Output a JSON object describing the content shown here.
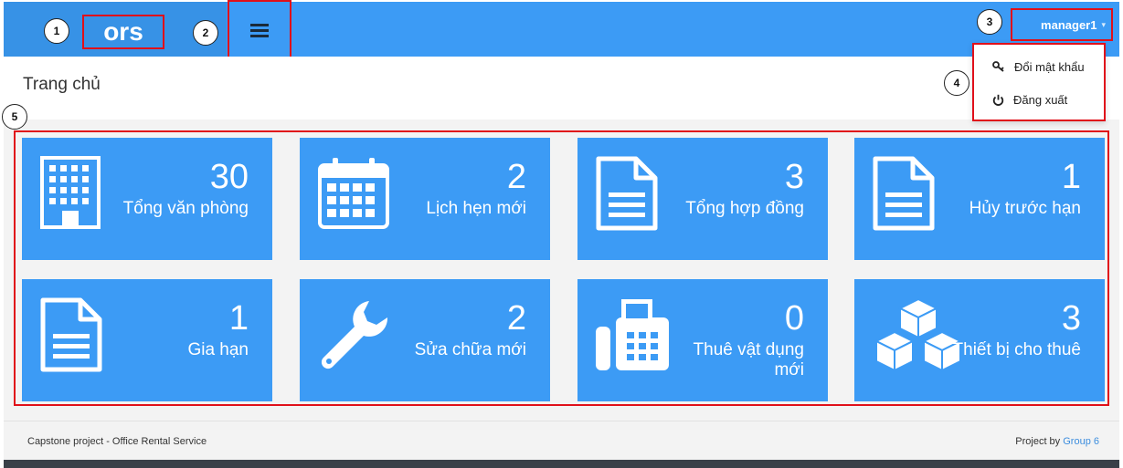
{
  "header": {
    "brand": "ors",
    "user": "manager1"
  },
  "user_dropdown": {
    "items": [
      {
        "label": "Đổi mật khẩu",
        "icon": "key-icon"
      },
      {
        "label": "Đăng xuất",
        "icon": "power-icon"
      }
    ]
  },
  "page": {
    "title": "Trang chủ"
  },
  "tiles": [
    {
      "value": "30",
      "label": "Tổng văn phòng",
      "icon": "building-icon"
    },
    {
      "value": "2",
      "label": "Lịch hẹn mới",
      "icon": "calendar-icon"
    },
    {
      "value": "3",
      "label": "Tổng hợp đồng",
      "icon": "document-icon"
    },
    {
      "value": "1",
      "label": "Hủy trước hạn",
      "icon": "document-icon"
    },
    {
      "value": "1",
      "label": "Gia hạn",
      "icon": "document-icon"
    },
    {
      "value": "2",
      "label": "Sửa chữa mới",
      "icon": "wrench-icon"
    },
    {
      "value": "0",
      "label": "Thuê vật dụng mới",
      "icon": "fax-icon"
    },
    {
      "value": "3",
      "label": "Thiết bị cho thuê",
      "icon": "cubes-icon"
    }
  ],
  "callouts": [
    "1",
    "2",
    "3",
    "4",
    "5"
  ],
  "footer": {
    "left": "Capstone project - Office Rental Service",
    "right_prefix": "Project by",
    "right_link": "Group 6"
  },
  "colors": {
    "topbar": "#3c9bf5",
    "brand_bg": "#3792e6",
    "tile": "#3c9bf5",
    "annotation": "#e0101a",
    "link": "#3c8dde"
  }
}
